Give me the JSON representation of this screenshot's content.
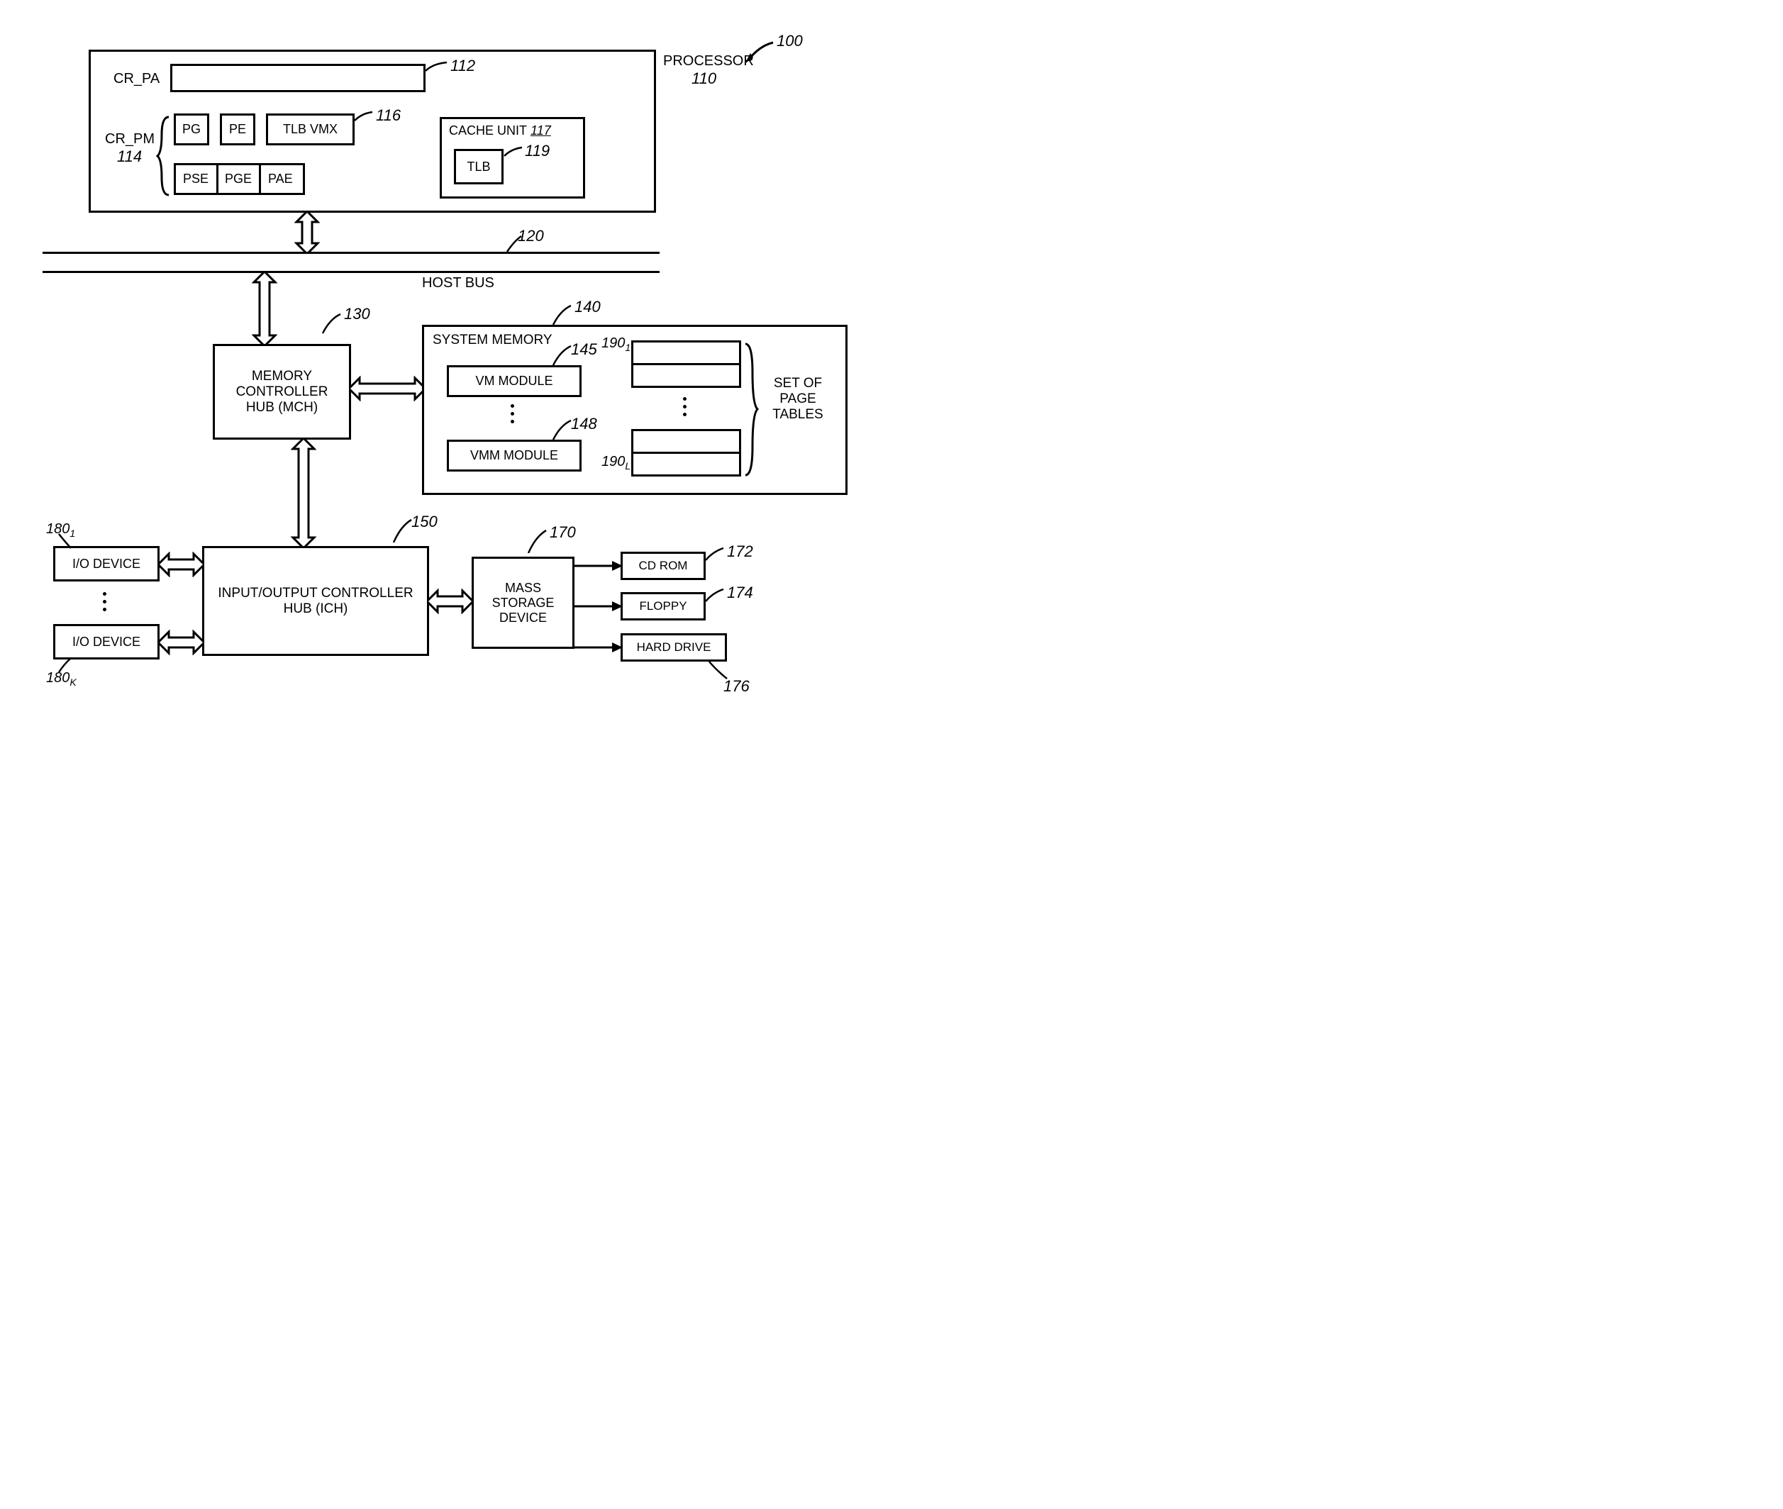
{
  "refs": {
    "system": "100",
    "processor": "110",
    "cr_pa": "112",
    "cr_pm": "114",
    "cr_pm_detail": "116",
    "cache_unit": "117",
    "tlb": "119",
    "host_bus": "120",
    "mch": "130",
    "sys_mem": "140",
    "vm_module": "145",
    "vmm_module": "148",
    "ich": "150",
    "mass_storage": "170",
    "cdrom": "172",
    "floppy": "174",
    "hdd": "176",
    "io_first": "180",
    "io_first_sub": "1",
    "io_last": "180",
    "io_last_sub": "K",
    "pt_first": "190",
    "pt_first_sub": "1",
    "pt_last": "190",
    "pt_last_sub": "L"
  },
  "labels": {
    "processor": "PROCESSOR",
    "cr_pa": "CR_PA",
    "cr_pm": "CR_PM",
    "pg": "PG",
    "pe": "PE",
    "tlb_vmx": "TLB VMX",
    "pse": "PSE",
    "pge": "PGE",
    "pae": "PAE",
    "cache_unit": "CACHE UNIT",
    "tlb": "TLB",
    "host_bus": "HOST BUS",
    "mch": "MEMORY CONTROLLER HUB (MCH)",
    "sys_mem": "SYSTEM MEMORY",
    "vm_module": "VM MODULE",
    "vmm_module": "VMM MODULE",
    "set_of_pt": "SET OF PAGE TABLES",
    "io_device": "I/O DEVICE",
    "ich": "INPUT/OUTPUT CONTROLLER HUB (ICH)",
    "mass_storage": "MASS STORAGE DEVICE",
    "cdrom": "CD ROM",
    "floppy": "FLOPPY",
    "hdd": "HARD DRIVE"
  }
}
